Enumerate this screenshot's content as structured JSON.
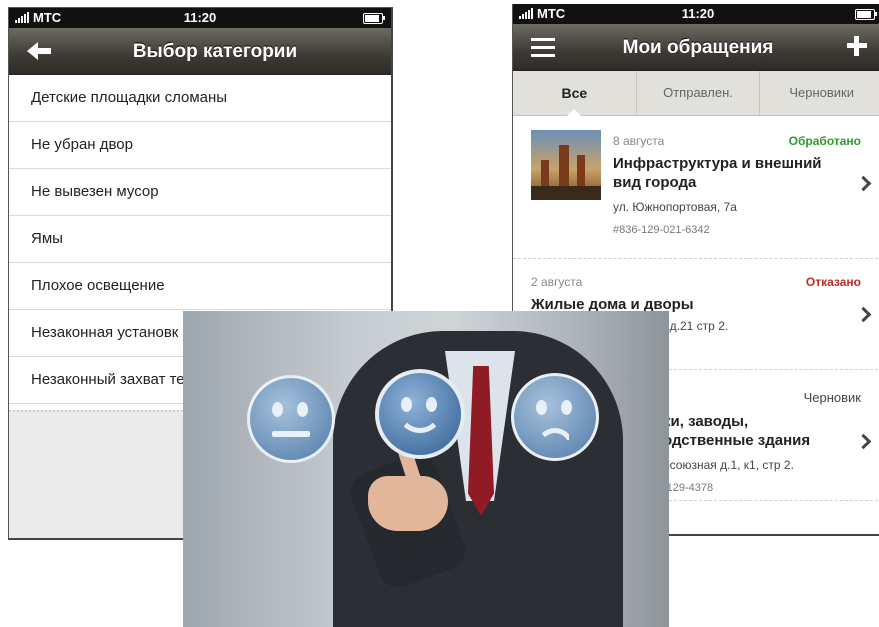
{
  "left_phone": {
    "status": {
      "carrier": "MTC",
      "time": "11:20"
    },
    "nav": {
      "title": "Выбор категории",
      "back_icon": "back-arrow-icon"
    },
    "categories": [
      "Детские площадки сломаны",
      "Не убран двор",
      "Не вывезен мусор",
      "Ямы",
      "Плохое освещение",
      "Незаконная установк",
      "Незаконный захват те"
    ]
  },
  "right_phone": {
    "status": {
      "carrier": "MTC",
      "time": "11:20"
    },
    "nav": {
      "title": "Мои обращения",
      "menu_icon": "hamburger-menu-icon",
      "add_icon": "plus-icon"
    },
    "tabs": [
      "Все",
      "Отправлен.",
      "Черновики"
    ],
    "active_tab": "Все",
    "requests": [
      {
        "date": "8 августа",
        "status": "Обработано",
        "status_color": "#2e9a2e",
        "title_line1": "Инфраструктура и внешний",
        "title_line2": "вид города",
        "address": "ул. Южнопортовая, 7а",
        "number": "#836-129-021-6342"
      },
      {
        "date": "2 августа",
        "status": "Отказано",
        "status_color": "#c0282a",
        "title_line1": "Жилые дома и дворы",
        "address": ", д.21 стр 2."
      },
      {
        "status": "Черновик",
        "status_color": "#444444",
        "title_line1": "ки, заводы,",
        "title_line2": "одственные здания",
        "address": "осоюзная д.1, к1, стр 2.",
        "number": "-129-4378"
      }
    ]
  },
  "overlay": {
    "icons": [
      "neutral-face-icon",
      "happy-face-icon",
      "sad-face-icon"
    ]
  }
}
